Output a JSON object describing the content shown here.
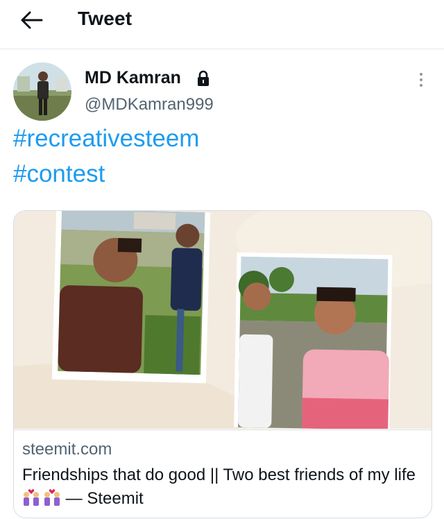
{
  "header": {
    "title": "Tweet"
  },
  "tweet": {
    "author": {
      "display_name": "MD Kamran",
      "handle": "@MDKamran999",
      "protected": true
    },
    "hashtags": [
      "#recreativesteem",
      "#contest"
    ],
    "card": {
      "domain": "steemit.com",
      "title_prefix": "Friendships that do good || Two best friends of my life",
      "title_suffix": " — Steemit",
      "emoji": "couple-with-heart-emoji"
    }
  },
  "colors": {
    "link": "#1d9bf0",
    "secondary_text": "#536471",
    "border": "#e6e9ec"
  }
}
